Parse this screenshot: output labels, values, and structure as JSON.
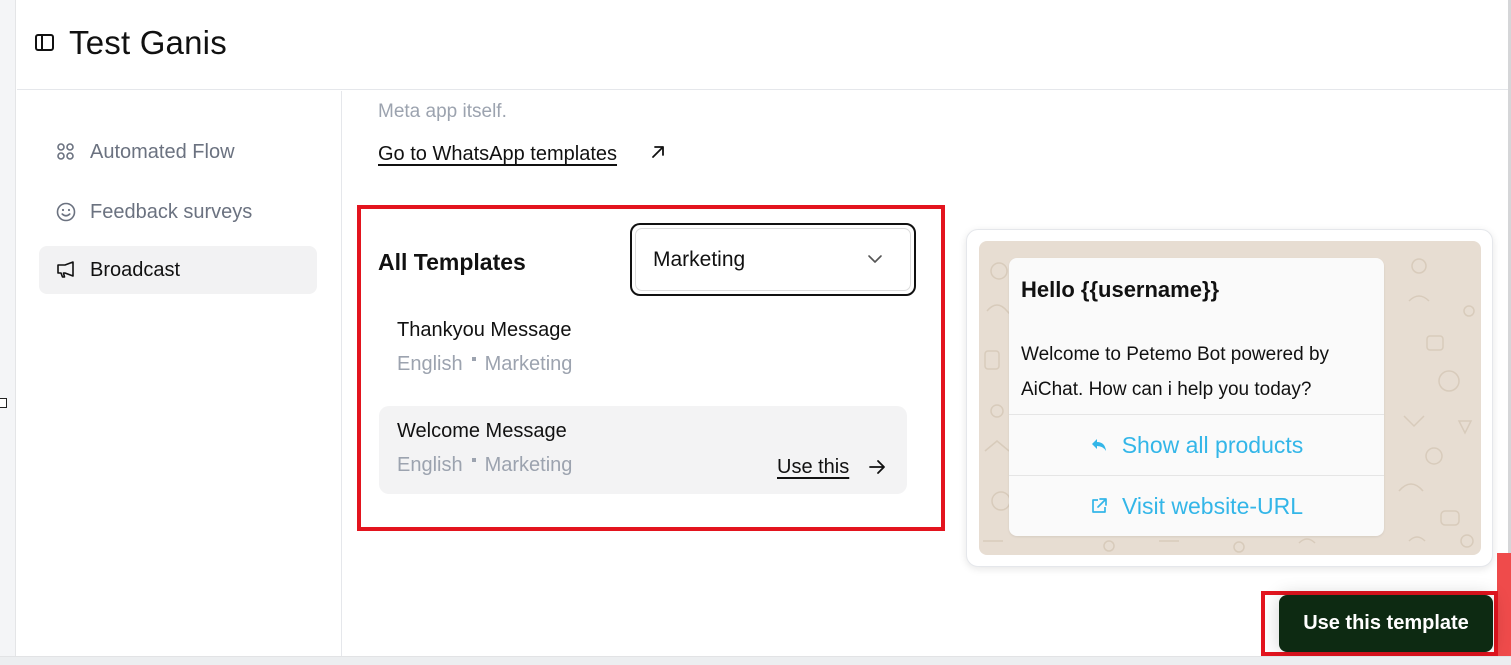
{
  "header": {
    "title": "Test Ganis",
    "sidebar_toggle_icon": "sidebar-panel-icon"
  },
  "sidebar": {
    "items": [
      {
        "label": "Automated Flow",
        "icon": "grid-circles-icon",
        "active": false
      },
      {
        "label": "Feedback surveys",
        "icon": "smiley-icon",
        "active": false
      },
      {
        "label": "Broadcast",
        "icon": "megaphone-icon",
        "active": true
      }
    ]
  },
  "main": {
    "clipped_line": "... ... ... ... ... ... ... ... ... ... ... ... ... ...",
    "meta_line": "Meta app itself.",
    "whatsapp_link": "Go to WhatsApp templates",
    "templates": {
      "heading": "All Templates",
      "category_select": {
        "value": "Marketing"
      },
      "items": [
        {
          "name": "Thankyou Message",
          "language": "English",
          "category": "Marketing",
          "hovered": false
        },
        {
          "name": "Welcome Message",
          "language": "English",
          "category": "Marketing",
          "hovered": true,
          "action": "Use this"
        }
      ]
    },
    "preview": {
      "title": "Hello {{username}}",
      "body": "Welcome to Petemo Bot powered by AiChat. How can i help you today?",
      "buttons": [
        {
          "label": "Show all products",
          "icon": "reply-icon"
        },
        {
          "label": "Visit website-URL",
          "icon": "external-link-icon"
        }
      ]
    },
    "use_template_button": "Use this template"
  },
  "colors": {
    "highlight_outline": "#e3141e",
    "primary_button": "#0d2a12",
    "link_blue": "#33b6e8",
    "chat_background": "#e7ddd2"
  }
}
